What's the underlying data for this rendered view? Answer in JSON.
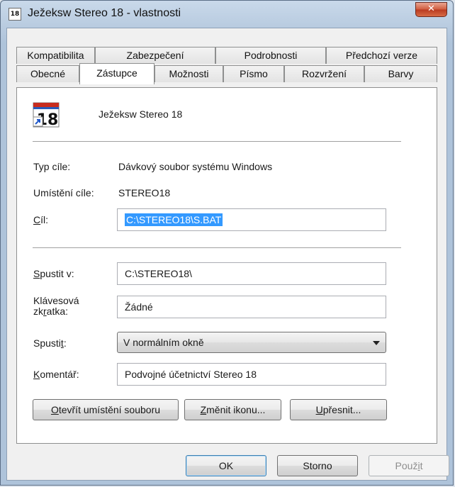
{
  "window": {
    "title": "Ježeksw Stereo 18 - vlastnosti",
    "app_icon_text": "18",
    "close_glyph": "✕"
  },
  "tabs_row1": [
    "Kompatibilita",
    "Zabezpečení",
    "Podrobnosti",
    "Předchozí verze"
  ],
  "tabs_row2": [
    "Obecné",
    "Zástupce",
    "Možnosti",
    "Písmo",
    "Rozvržení",
    "Barvy"
  ],
  "active_tab": "Zástupce",
  "shortcut": {
    "icon": "shortcut-18-icon",
    "icon_text": "18",
    "name": "Ježeksw Stereo 18"
  },
  "info": {
    "target_type_label": "Typ cíle:",
    "target_type_value": "Dávkový soubor systému Windows",
    "target_location_label": "Umístění cíle:",
    "target_location_value": "STEREO18",
    "target_label_u": "C",
    "target_label_rest": "íl:",
    "target_value": "C:\\STEREO18\\S.BAT"
  },
  "fields": {
    "start_in_label_u": "S",
    "start_in_label_rest": "pustit v:",
    "start_in_value": "C:\\STEREO18\\",
    "hotkey_label_line1": "Klávesová",
    "hotkey_label_pre": "zk",
    "hotkey_label_u": "r",
    "hotkey_label_post": "atka:",
    "hotkey_value": "Žádné",
    "run_label_pre": "Spusti",
    "run_label_u": "t",
    "run_label_post": ":",
    "run_value": "V normálním okně",
    "comment_label_u": "K",
    "comment_label_rest": "omentář:",
    "comment_value": "Podvojné účetnictví Stereo 18"
  },
  "panel_buttons": {
    "open_location_u": "O",
    "open_location_rest": "tevřít umístění souboru",
    "change_icon_u": "Z",
    "change_icon_rest": "měnit ikonu...",
    "advanced_u": "U",
    "advanced_rest": "přesnit..."
  },
  "dialog_buttons": {
    "ok": "OK",
    "cancel": "Storno",
    "apply_pre": "Použ",
    "apply_u": "i",
    "apply_post": "t"
  },
  "colors": {
    "selection": "#3399ff",
    "close_button": "#c74a2e",
    "title_bar": "#b7cadf"
  }
}
